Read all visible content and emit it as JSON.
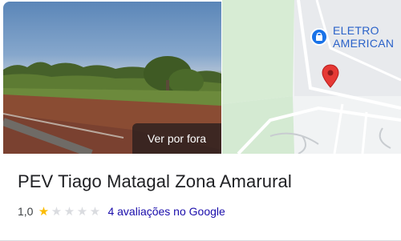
{
  "photo": {
    "button_label": "Ver por fora"
  },
  "map": {
    "poi_label_line1": "ELETRO",
    "poi_label_line2": "AMERICAN"
  },
  "place": {
    "name": "PEV Tiago Matagal Zona Amarural",
    "rating": "1,0",
    "rating_value": 1,
    "rating_max": 5,
    "reviews_text": "4 avaliações no Google"
  },
  "colors": {
    "star_filled": "#fbbc04",
    "star_empty": "#dadce0",
    "link": "#1a0dab",
    "map_label": "#2a62c9",
    "pin": "#e53935"
  },
  "icons": {
    "poi": "shopping-bag-icon",
    "pin": "map-pin-icon"
  }
}
